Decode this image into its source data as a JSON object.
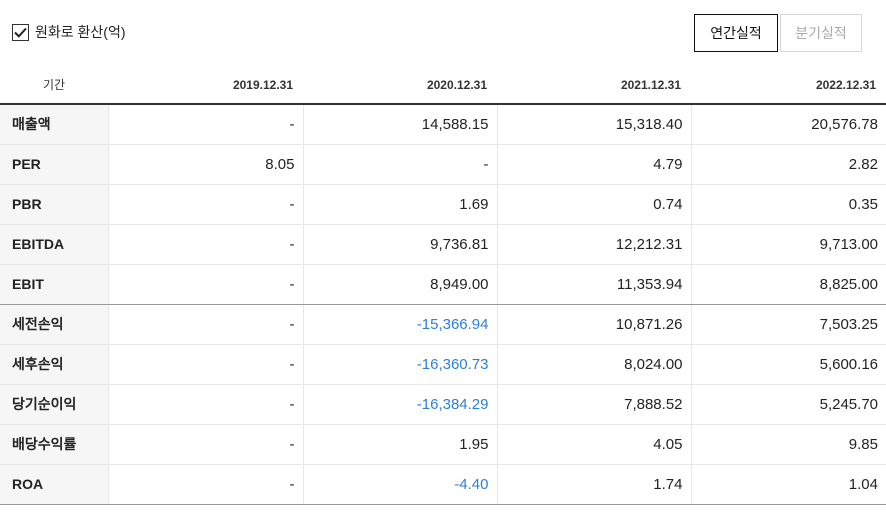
{
  "toggle": {
    "label": "원화로 환산(억)",
    "checked": true
  },
  "tabs": [
    {
      "label": "연간실적",
      "active": true
    },
    {
      "label": "분기실적",
      "active": false
    }
  ],
  "table": {
    "corner": "기간",
    "columns": [
      "2019.12.31",
      "2020.12.31",
      "2021.12.31",
      "2022.12.31"
    ],
    "rows": [
      {
        "label": "매출액",
        "values": [
          "-",
          "14,588.15",
          "15,318.40",
          "20,576.78"
        ]
      },
      {
        "label": "PER",
        "values": [
          "8.05",
          "-",
          "4.79",
          "2.82"
        ]
      },
      {
        "label": "PBR",
        "values": [
          "-",
          "1.69",
          "0.74",
          "0.35"
        ]
      },
      {
        "label": "EBITDA",
        "values": [
          "-",
          "9,736.81",
          "12,212.31",
          "9,713.00"
        ]
      },
      {
        "label": "EBIT",
        "values": [
          "-",
          "8,949.00",
          "11,353.94",
          "8,825.00"
        ]
      },
      {
        "label": "세전손익",
        "values": [
          "-",
          "-15,366.94",
          "10,871.26",
          "7,503.25"
        ]
      },
      {
        "label": "세후손익",
        "values": [
          "-",
          "-16,360.73",
          "8,024.00",
          "5,600.16"
        ]
      },
      {
        "label": "당기순이익",
        "values": [
          "-",
          "-16,384.29",
          "7,888.52",
          "5,245.70"
        ]
      },
      {
        "label": "배당수익률",
        "values": [
          "-",
          "1.95",
          "4.05",
          "9.85"
        ]
      },
      {
        "label": "ROA",
        "values": [
          "-",
          "-4.40",
          "1.74",
          "1.04"
        ]
      }
    ]
  },
  "colors": {
    "negative": "#2d7fd8",
    "label_bg": "#f6f6f6"
  }
}
